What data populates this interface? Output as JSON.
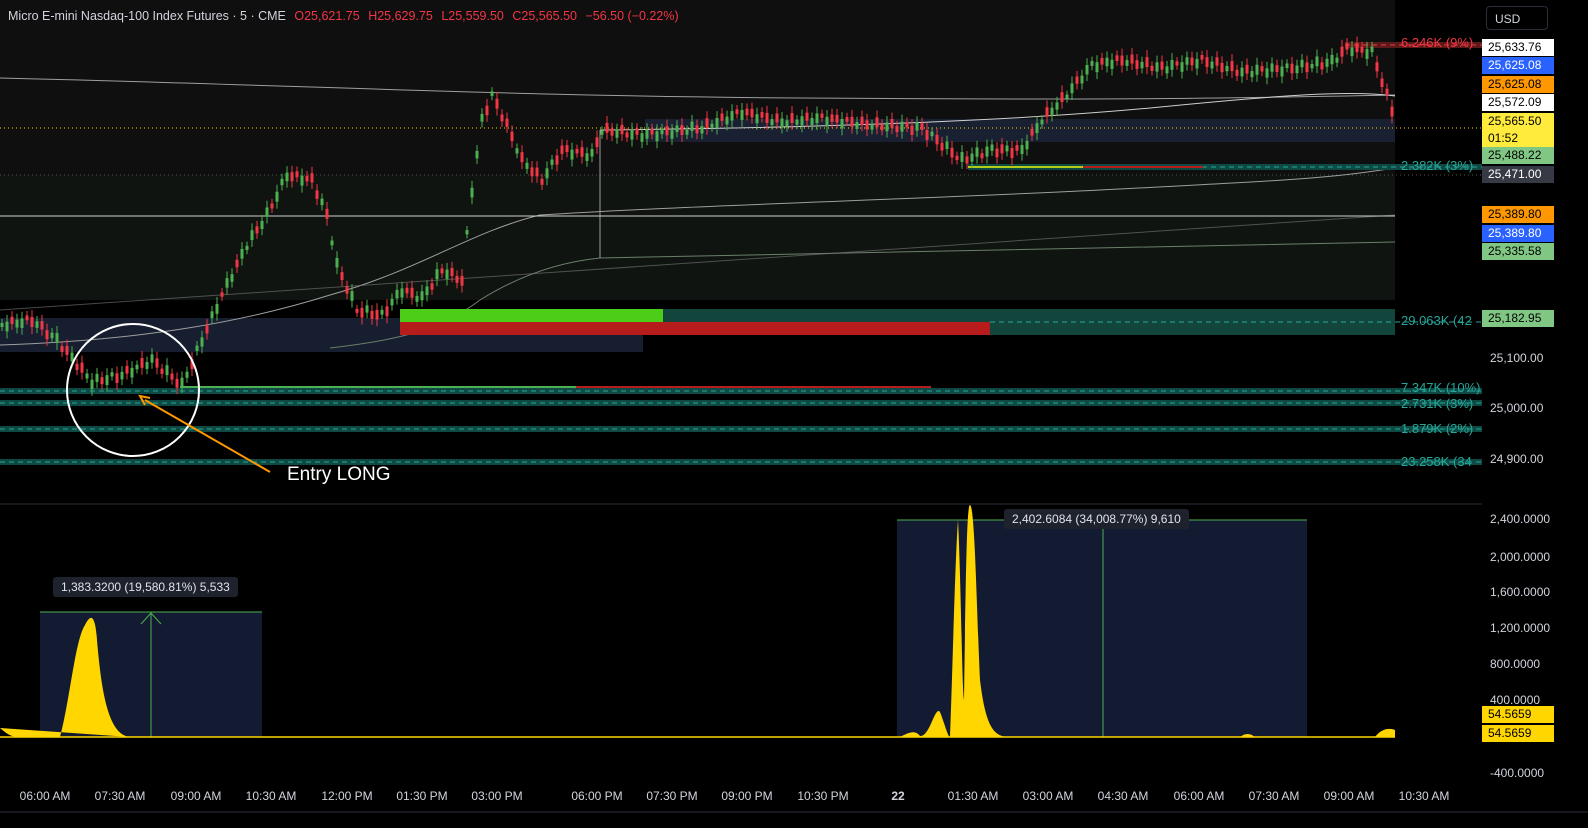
{
  "header": {
    "symbol": "Micro E-mini Nasdaq-100 Index Futures · 5 · CME",
    "open": "O25,621.75",
    "high": "H25,629.75",
    "low": "L25,559.50",
    "close": "C25,565.50",
    "change": "−56.50 (−0.22%)"
  },
  "currency_button": "USD",
  "price_axis": [
    "25,100.00",
    "25,000.00",
    "24,900.00"
  ],
  "price_labels": [
    {
      "text": "25,633.76",
      "bg": "#ffffff",
      "fg": "#000000"
    },
    {
      "text": "25,625.08",
      "bg": "#2962ff",
      "fg": "#ffffff"
    },
    {
      "text": "25,625.08",
      "bg": "#ff9800",
      "fg": "#000000"
    },
    {
      "text": "25,572.09",
      "bg": "#ffffff",
      "fg": "#000000"
    },
    {
      "text": "25,565.50",
      "bg": "#ffeb3b",
      "fg": "#000000"
    },
    {
      "text": "01:52",
      "bg": "#ffeb3b",
      "fg": "#000000"
    },
    {
      "text": "25,488.22",
      "bg": "#81c784",
      "fg": "#000000"
    },
    {
      "text": "25,471.00",
      "bg": "#363a45",
      "fg": "#ffffff"
    },
    {
      "text": "25,389.80",
      "bg": "#ff9800",
      "fg": "#000000"
    },
    {
      "text": "25,389.80",
      "bg": "#2962ff",
      "fg": "#ffffff"
    },
    {
      "text": "25,335.58",
      "bg": "#81c784",
      "fg": "#000000"
    },
    {
      "text": "25,182.95",
      "bg": "#81c784",
      "fg": "#000000"
    }
  ],
  "volume_labels": [
    "6.246K (9%)",
    "2.382K (3%)",
    "29.063K (42",
    "7.347K (10%)",
    "2.731K (3%)",
    "1.879K (2%)",
    "23.258K (34"
  ],
  "annotation": "Entry LONG",
  "indicator": {
    "axis": [
      "2,400.0000",
      "2,000.0000",
      "1,600.0000",
      "1,200.0000",
      "800.0000",
      "400.0000",
      "-400.0000"
    ],
    "value_labels": [
      "54.5659",
      "54.5659"
    ],
    "measure_1": "1,383.3200 (19,580.81%) 5,533",
    "measure_2": "2,402.6084 (34,008.77%) 9,610"
  },
  "time_axis": [
    "06:00 AM",
    "07:30 AM",
    "09:00 AM",
    "10:30 AM",
    "12:00 PM",
    "01:30 PM",
    "03:00 PM",
    "06:00 PM",
    "07:30 PM",
    "09:00 PM",
    "10:30 PM",
    "22",
    "01:30 AM",
    "03:00 AM",
    "04:30 AM",
    "06:00 AM",
    "07:30 AM",
    "09:00 AM",
    "10:30 AM"
  ],
  "colors": {
    "up": "#4caf50",
    "down": "#f23645",
    "yellow": "#ffd600",
    "teal": "#26a69a"
  },
  "icons": {
    "entry_circle": "circle-marker",
    "entry_arrow": "arrow-pointer"
  }
}
